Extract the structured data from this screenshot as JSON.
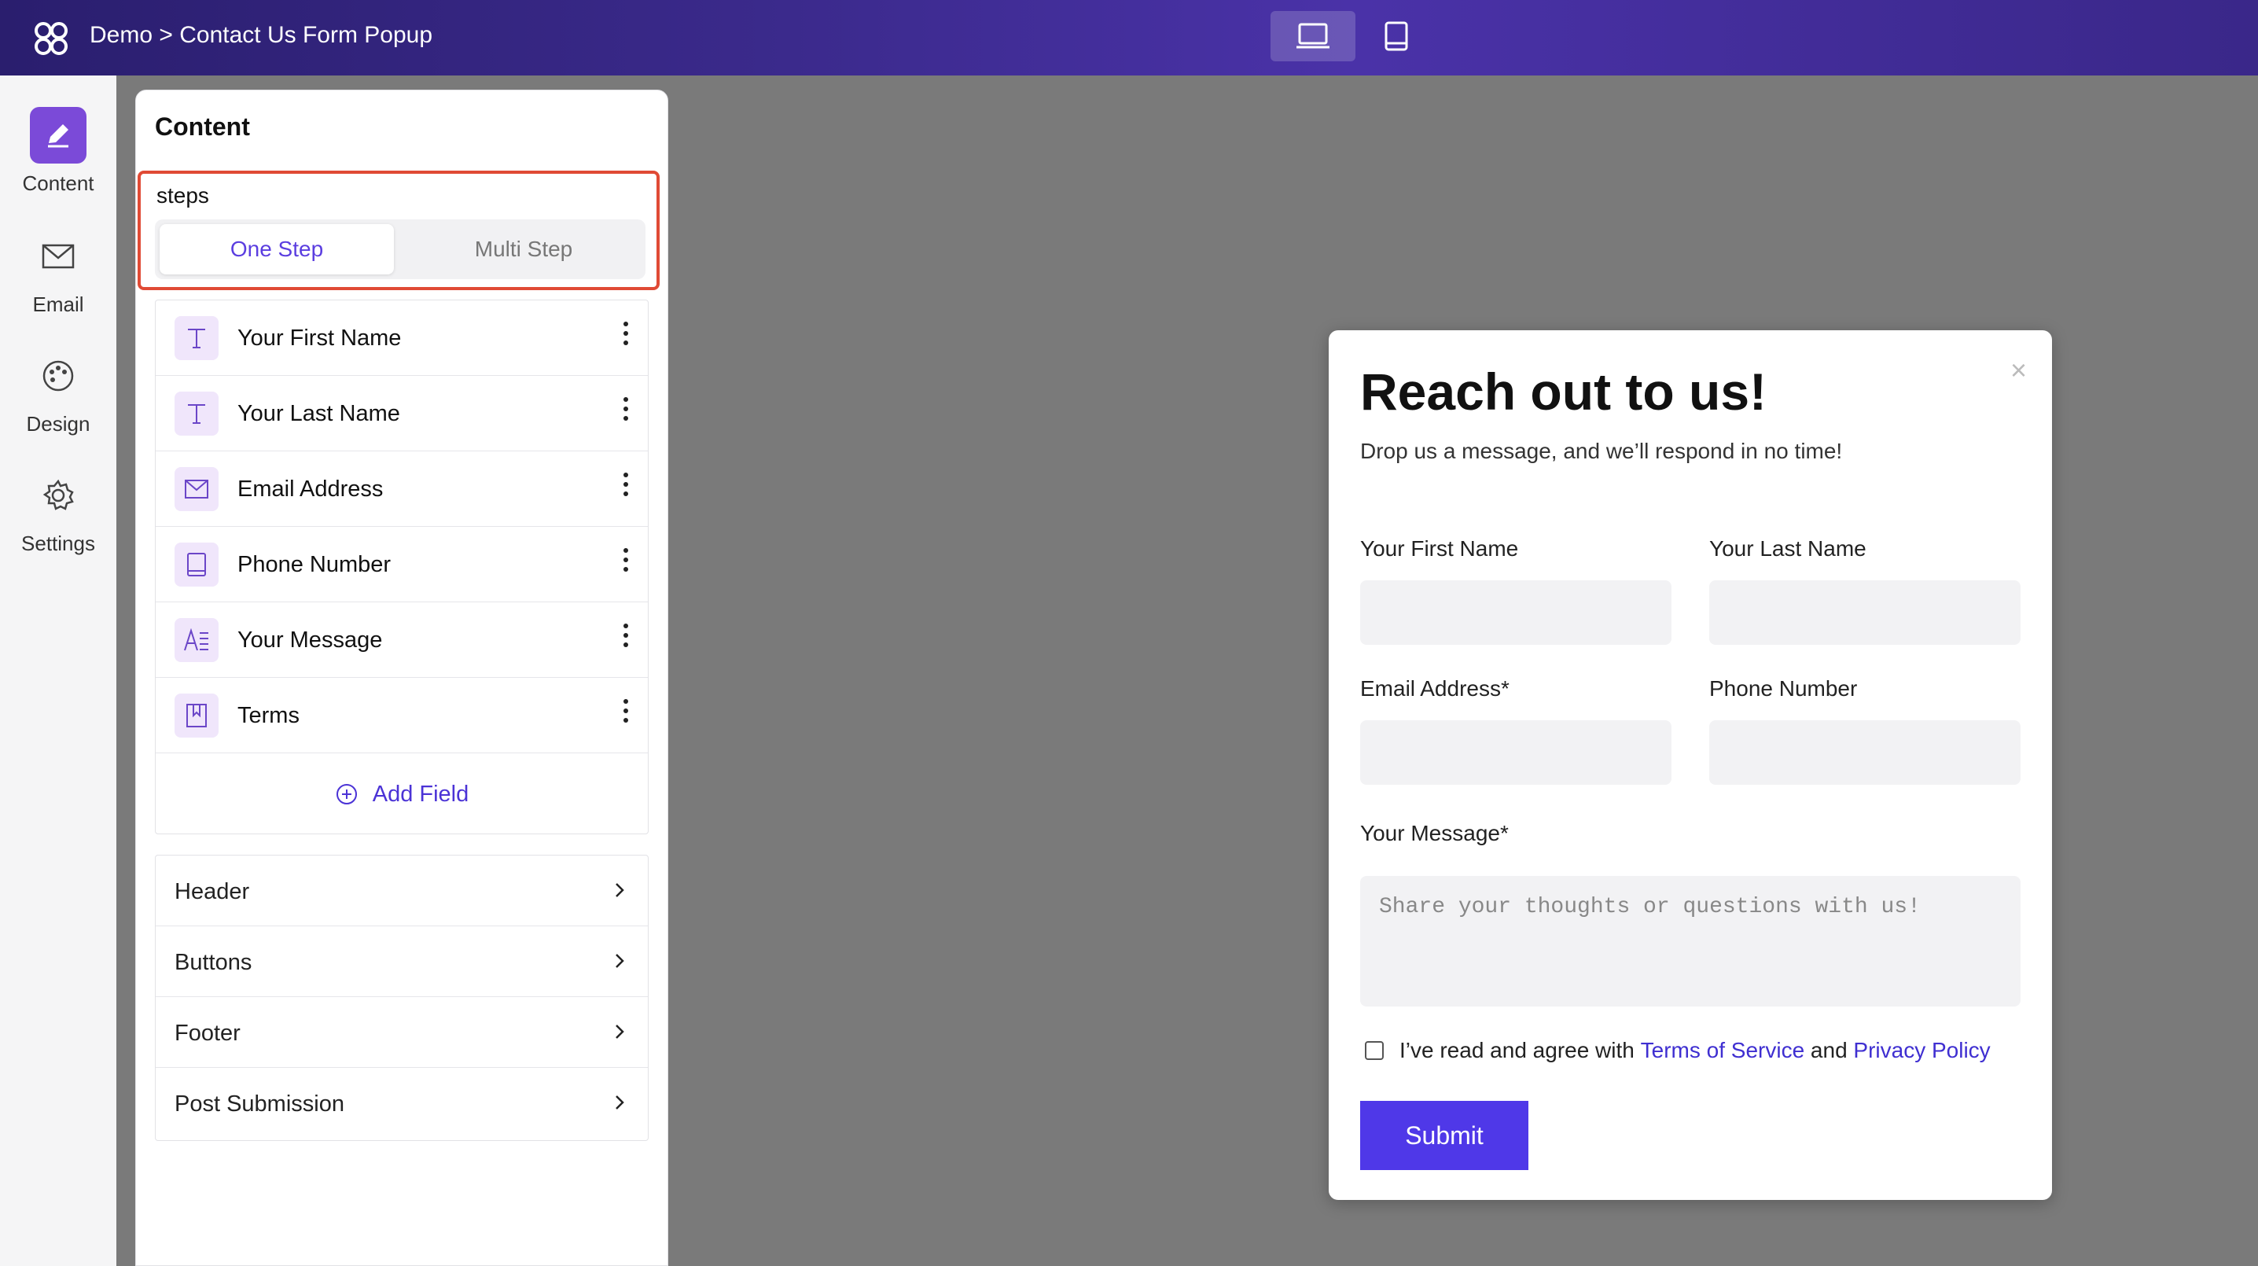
{
  "topbar": {
    "breadcrumb": "Demo > Contact Us Form Popup",
    "views": [
      "desktop-icon",
      "tablet-icon"
    ],
    "active_view": "desktop"
  },
  "rail": {
    "items": [
      {
        "label": "Content",
        "icon": "pencil-icon",
        "active": true
      },
      {
        "label": "Email",
        "icon": "mail-icon",
        "active": false
      },
      {
        "label": "Design",
        "icon": "palette-icon",
        "active": false
      },
      {
        "label": "Settings",
        "icon": "gear-icon",
        "active": false
      }
    ]
  },
  "panel": {
    "title": "Content",
    "steps_label": "steps",
    "steps_options": [
      "One Step",
      "Multi Step"
    ],
    "steps_selected": "One Step",
    "fields": [
      {
        "label": "Your First Name",
        "icon": "text-icon"
      },
      {
        "label": "Your Last Name",
        "icon": "text-icon"
      },
      {
        "label": "Email Address",
        "icon": "mail-icon"
      },
      {
        "label": "Phone Number",
        "icon": "phone-icon"
      },
      {
        "label": "Your Message",
        "icon": "paragraph-icon"
      },
      {
        "label": "Terms",
        "icon": "bookmark-icon"
      }
    ],
    "add_field": "Add Field",
    "sections": [
      "Header",
      "Buttons",
      "Footer",
      "Post Submission"
    ]
  },
  "popup": {
    "close": "×",
    "title": "Reach out to us!",
    "subtitle": "Drop us a message, and we’ll respond in no time!",
    "first_name_label": "Your First Name",
    "last_name_label": "Your Last Name",
    "email_label": "Email Address*",
    "phone_label": "Phone Number",
    "message_label": "Your Message*",
    "message_placeholder": "Share your thoughts or questions with us!",
    "terms_prefix": "I’ve read and agree with ",
    "terms_link": "Terms of Service",
    "terms_and": " and ",
    "privacy_link": "Privacy Policy",
    "submit": "Submit"
  },
  "colors": {
    "accent": "#4f38e8",
    "highlight": "#e04a35",
    "rail_active": "#7b4ad8"
  }
}
